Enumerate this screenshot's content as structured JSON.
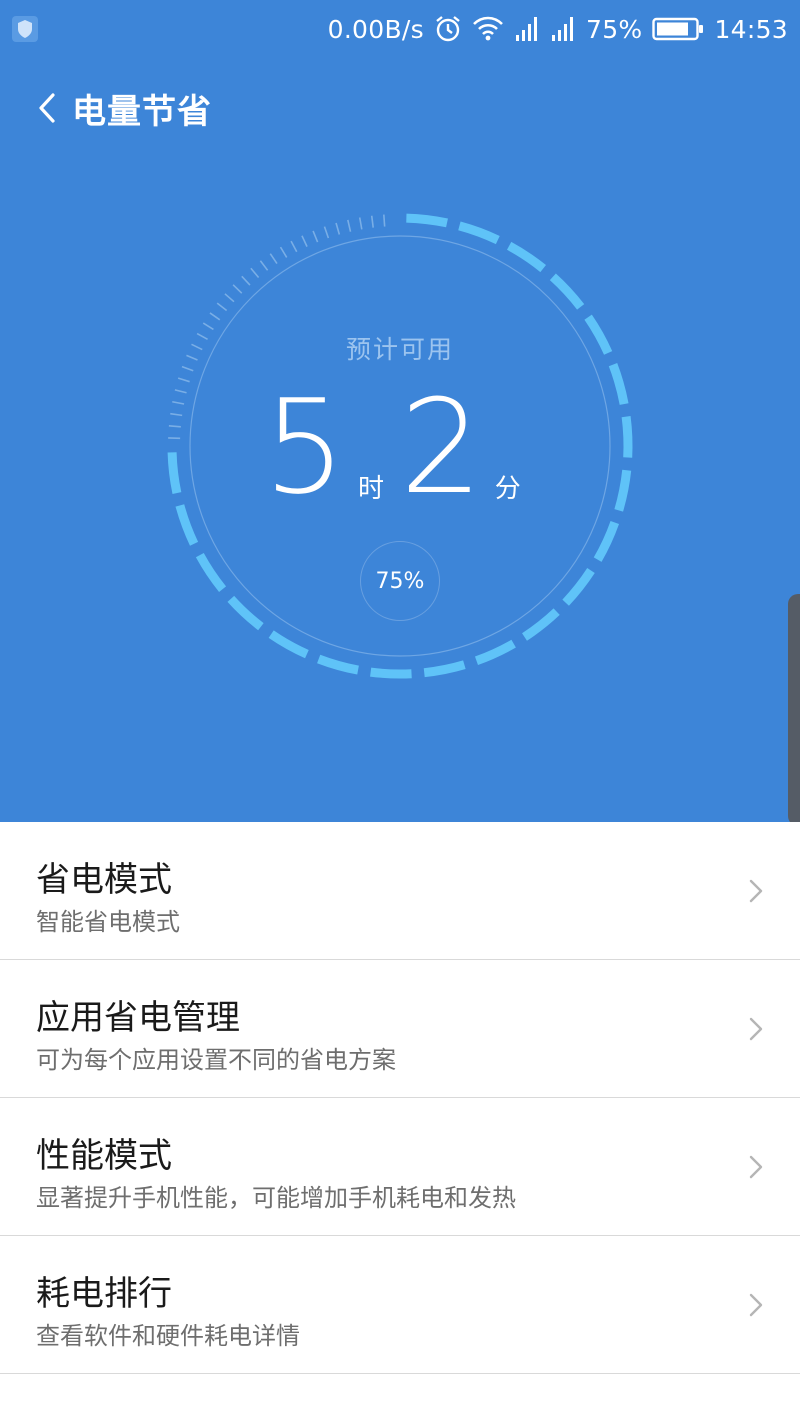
{
  "status_bar": {
    "network_speed": "0.00B/s",
    "battery_percent": "75%",
    "time": "14:53",
    "icons": [
      "shield-icon",
      "alarm-icon",
      "wifi-icon",
      "signal-icon",
      "signal-icon",
      "battery-icon"
    ]
  },
  "header": {
    "title": "电量节省",
    "back_icon": "back-arrow-icon"
  },
  "gauge": {
    "label": "预计可用",
    "hours": "5",
    "hours_unit": "时",
    "minutes": "2",
    "minutes_unit": "分",
    "percent_text": "75%",
    "battery_level": 0.75
  },
  "list": {
    "items": [
      {
        "title": "省电模式",
        "subtitle": "智能省电模式"
      },
      {
        "title": "应用省电管理",
        "subtitle": "可为每个应用设置不同的省电方案"
      },
      {
        "title": "性能模式",
        "subtitle": "显著提升手机性能，可能增加手机耗电和发热"
      },
      {
        "title": "耗电排行",
        "subtitle": "查看软件和硬件耗电详情"
      }
    ]
  },
  "colors": {
    "hero_bg": "#3d85d8",
    "gauge_active": "#5fc3f8",
    "gauge_inactive": "#79aee6"
  }
}
